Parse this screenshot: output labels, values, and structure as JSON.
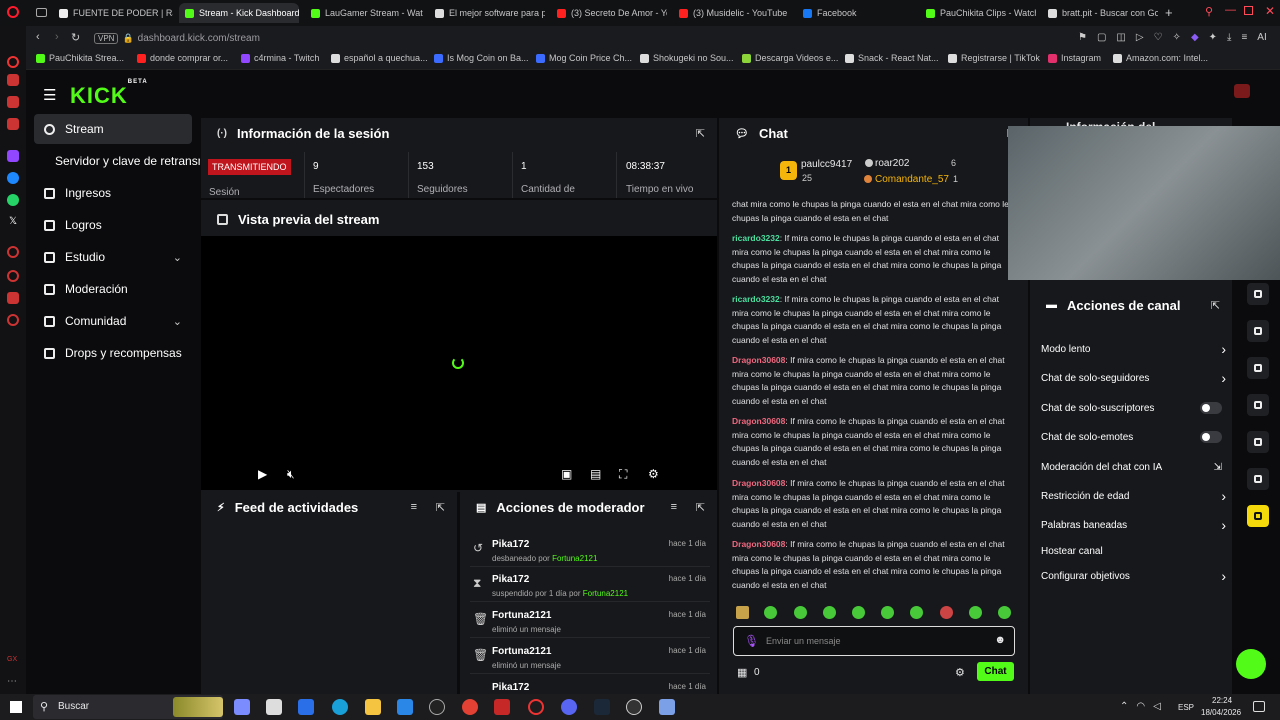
{
  "browser": {
    "tabs": [
      {
        "label": "FUENTE DE PODER | Ral",
        "fav": "#eeeeee"
      },
      {
        "label": "Stream - Kick Dashboard",
        "fav": "#53fc18",
        "active": true
      },
      {
        "label": "LauGamer Stream - Wat",
        "fav": "#53fc18"
      },
      {
        "label": "El mejor software para p",
        "fav": "#dddddd"
      },
      {
        "label": "(3) Secreto De Amor - Yo",
        "fav": "#ff2020"
      },
      {
        "label": "(3) Musidelic - YouTube",
        "fav": "#ff2020"
      },
      {
        "label": "Facebook",
        "fav": "#1877f2"
      },
      {
        "label": "PauChikita Clips - Watch",
        "fav": "#53fc18"
      },
      {
        "label": "bratt.pit - Buscar con Go",
        "fav": "#dddddd"
      }
    ],
    "url_prefix": "VPN",
    "url": "dashboard.kick.com/stream",
    "bookmarks": [
      {
        "label": "PauChikita Strea...",
        "color": "#53fc18"
      },
      {
        "label": "donde comprar or...",
        "color": "#ff2020"
      },
      {
        "label": "c4rmina - Twitch",
        "color": "#9146ff"
      },
      {
        "label": "español a quechua...",
        "color": "#dddddd"
      },
      {
        "label": "Is Mog Coin on Ba...",
        "color": "#3b6cff"
      },
      {
        "label": "Mog Coin Price Ch...",
        "color": "#3b6cff"
      },
      {
        "label": "Shokugeki no Sou...",
        "color": "#dddddd"
      },
      {
        "label": "Descarga Videos e...",
        "color": "#8cd43a"
      },
      {
        "label": "Snack - React Nat...",
        "color": "#dddddd"
      },
      {
        "label": "Registrarse | TikTok",
        "color": "#dddddd"
      },
      {
        "label": "Instagram",
        "color": "#e1306c"
      },
      {
        "label": "Amazon.com: Intel...",
        "color": "#dddddd"
      }
    ]
  },
  "kick": {
    "logo": "KICK",
    "logo_badge": "BETA",
    "nav": [
      {
        "label": "Stream",
        "active": true
      },
      {
        "label": "Servidor y clave de retransm"
      },
      {
        "label": "Ingresos"
      },
      {
        "label": "Logros"
      },
      {
        "label": "Estudio",
        "chevron": true
      },
      {
        "label": "Moderación"
      },
      {
        "label": "Comunidad",
        "chevron": true
      },
      {
        "label": "Drops y recompensas"
      }
    ]
  },
  "session": {
    "title": "Información de la sesión",
    "live_badge": "TRANSMITIENDO",
    "live_label": "Sesión",
    "stats": [
      {
        "value": "9",
        "label": "Espectadores"
      },
      {
        "value": "153",
        "label": "Seguidores"
      },
      {
        "value": "1",
        "label": "Cantidad de"
      },
      {
        "value": "08:38:37",
        "label": "Tiempo en vivo"
      }
    ]
  },
  "preview": {
    "title": "Vista previa del stream"
  },
  "feed": {
    "title": "Feed de actividades"
  },
  "modactions": {
    "title": "Acciones de moderador",
    "items": [
      {
        "icon": "↺",
        "name": "Pika172",
        "desc": "desbaneado por ",
        "by": "Fortuna2121",
        "time": "hace 1 día"
      },
      {
        "icon": "⧗",
        "name": "Pika172",
        "desc": "suspendido por 1 día por ",
        "by": "Fortuna2121",
        "time": "hace 1 día"
      },
      {
        "icon": "🗑",
        "name": "Fortuna2121",
        "desc": "eliminó un mensaje",
        "by": "",
        "time": "hace 1 día"
      },
      {
        "icon": "🗑",
        "name": "Fortuna2121",
        "desc": "eliminó un mensaje",
        "by": "",
        "time": "hace 1 día"
      },
      {
        "icon": "",
        "name": "Pika172",
        "desc": "",
        "by": "",
        "time": "hace 1 día"
      }
    ]
  },
  "chat": {
    "title": "Chat",
    "leaders": [
      {
        "rank": "1",
        "name": "paulcc9417",
        "count": "25"
      },
      {
        "name": "roar202",
        "count": "6"
      },
      {
        "name": "Comandante_57",
        "count": "1"
      }
    ],
    "cut_text": "chat mira como le chupas la pinga cuando el esta en el chat mira como le chupas la pinga cuando el esta en el chat",
    "messages": [
      {
        "user": "ricardo3232",
        "color": "green",
        "text": ": If mira como le chupas la pinga cuando el esta en el chat mira como le chupas la pinga cuando el esta en el chat mira como le chupas la pinga cuando el esta en el chat mira como le chupas la pinga cuando el esta en el chat"
      },
      {
        "user": "ricardo3232",
        "color": "green",
        "text": ": If mira como le chupas la pinga cuando el esta en el chat mira como le chupas la pinga cuando el esta en el chat mira como le chupas la pinga cuando el esta en el chat mira como le chupas la pinga cuando el esta en el chat"
      },
      {
        "user": "Dragon30608",
        "color": "red",
        "text": ": If mira como le chupas la pinga cuando el esta en el chat mira como le chupas la pinga cuando el esta en el chat mira como le chupas la pinga cuando el esta en el chat mira como le chupas la pinga cuando el esta en el chat"
      },
      {
        "user": "Dragon30608",
        "color": "red",
        "text": ": If mira como le chupas la pinga cuando el esta en el chat mira como le chupas la pinga cuando el esta en el chat mira como le chupas la pinga cuando el esta en el chat mira como le chupas la pinga cuando el esta en el chat"
      },
      {
        "user": "Dragon30608",
        "color": "red",
        "text": ": If mira como le chupas la pinga cuando el esta en el chat mira como le chupas la pinga cuando el esta en el chat mira como le chupas la pinga cuando el esta en el chat mira como le chupas la pinga cuando el esta en el chat"
      },
      {
        "user": "Dragon30608",
        "color": "red",
        "text": ": If mira como le chupas la pinga cuando el esta en el chat mira como le chupas la pinga cuando el esta en el chat mira como le chupas la pinga cuando el esta en el chat mira como le chupas la pinga cuando el esta en el chat"
      }
    ],
    "input_placeholder": "Enviar un mensaje",
    "points": "0",
    "send_label": "Chat"
  },
  "channel": {
    "info_title": "Información del",
    "actions_title": "Acciones de canal",
    "actions": [
      {
        "label": "Modo lento",
        "kind": "arrow"
      },
      {
        "label": "Chat de solo-seguidores",
        "kind": "arrow"
      },
      {
        "label": "Chat de solo-suscriptores",
        "kind": "toggle"
      },
      {
        "label": "Chat de solo-emotes",
        "kind": "toggle"
      },
      {
        "label": "Moderación del chat con IA",
        "kind": "external"
      },
      {
        "label": "Restricción de edad",
        "kind": "arrow"
      },
      {
        "label": "Palabras baneadas",
        "kind": "arrow"
      },
      {
        "label": "Hostear canal",
        "kind": "none"
      },
      {
        "label": "Configurar objetivos",
        "kind": "arrow"
      }
    ]
  },
  "taskbar": {
    "search_label": "Buscar",
    "lang": "ESP",
    "time": "22:24",
    "date": "18/04/2026"
  }
}
